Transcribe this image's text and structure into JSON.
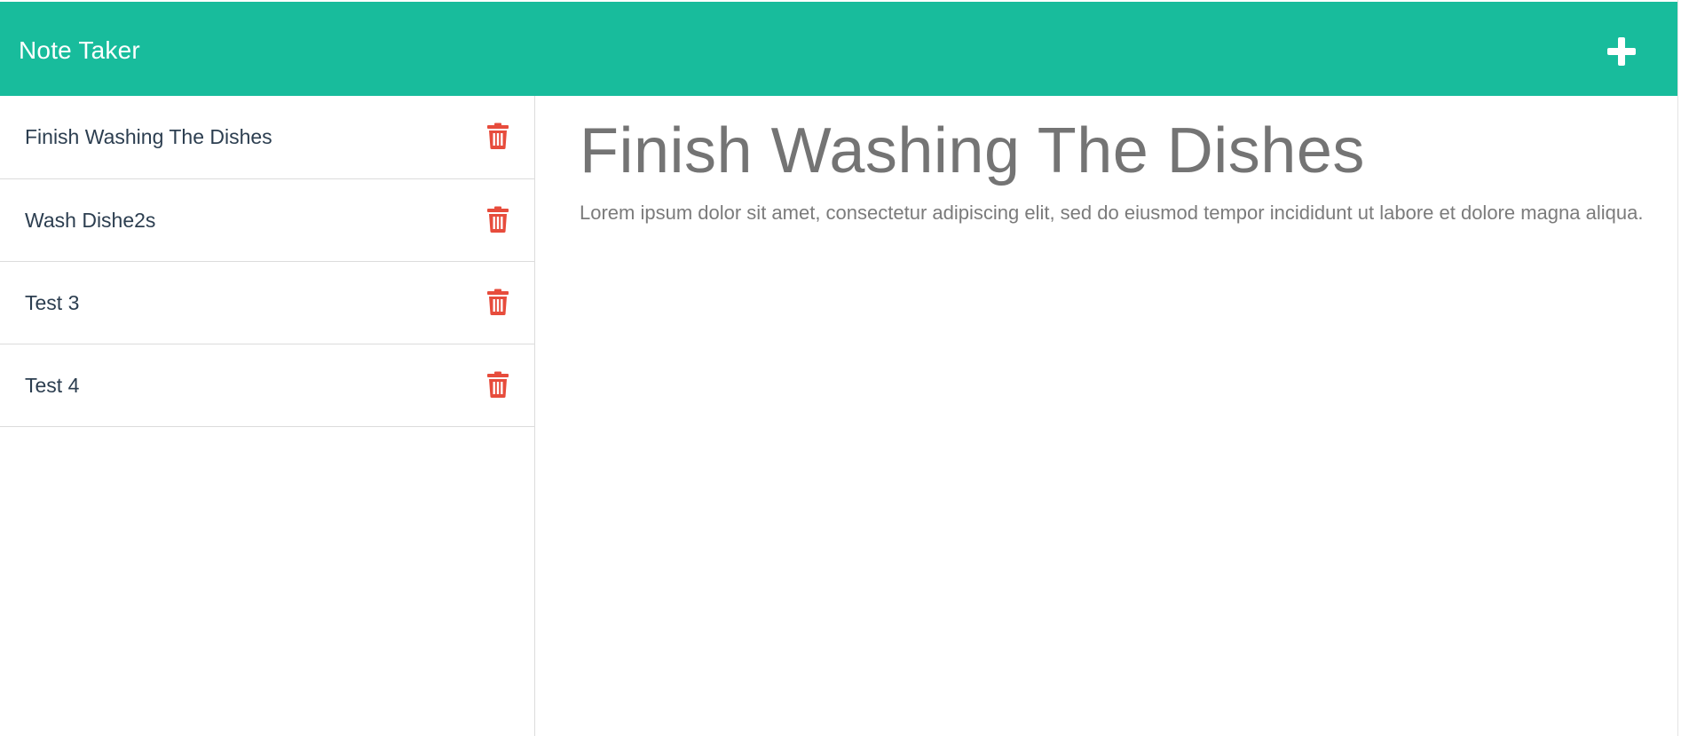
{
  "app": {
    "brand": "Note Taker",
    "add_icon": "plus-icon",
    "delete_icon": "trash-icon",
    "colors": {
      "navbar": "#18bc9c",
      "delete": "#e74c3c",
      "note_text": "#2c3e50",
      "muted_text": "#747474"
    }
  },
  "sidebar": {
    "notes": [
      {
        "title": "Finish Washing The Dishes"
      },
      {
        "title": "Wash Dishe2s"
      },
      {
        "title": "Test 3"
      },
      {
        "title": "Test 4"
      }
    ]
  },
  "main": {
    "note_title": "Finish Washing The Dishes",
    "note_text": "Lorem ipsum dolor sit amet, consectetur adipiscing elit, sed do eiusmod tempor incididunt ut labore et dolore magna aliqua."
  }
}
